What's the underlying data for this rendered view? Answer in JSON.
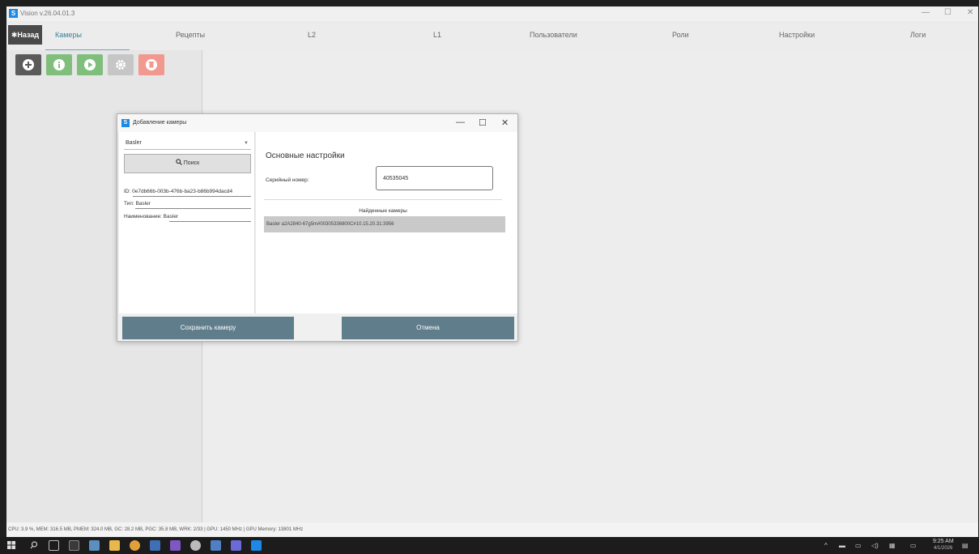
{
  "window": {
    "title": "Vision v.26.04.01.3"
  },
  "nav": {
    "back_label": "Назад",
    "tabs": [
      "Камеры",
      "Рецепты",
      "L2",
      "L1",
      "Пользователи",
      "Роли",
      "Настройки",
      "Логи"
    ],
    "active_tab": "Камеры"
  },
  "toolbar": {
    "buttons": [
      {
        "name": "add",
        "icon": "plus-circle-icon",
        "color": "#5a5a5a"
      },
      {
        "name": "info",
        "icon": "info-circle-icon",
        "color": "#7fbf7b"
      },
      {
        "name": "start",
        "icon": "play-circle-icon",
        "color": "#7fbf7b"
      },
      {
        "name": "settings",
        "icon": "gear-icon",
        "color": "#c6c6c6"
      },
      {
        "name": "delete",
        "icon": "trash-circle-icon",
        "color": "#f2998f"
      }
    ]
  },
  "dialog": {
    "title": "Добавление камеры",
    "camera_type": "Basler",
    "search_label": "Поиск",
    "id_line": "ID: 0e7db66b-003b-476b-ba23-b86b994dacd4",
    "type_line": "Тип: Basler",
    "name_line": "Наименование: Basler",
    "section_title": "Основные настройки",
    "serial_label": "Серийный номер:",
    "serial_value": "40535045",
    "found_title": "Найденные камеры",
    "found_items": [
      "Basler a2A2840-67g5m#00305336800C#10.15.20.31:3956"
    ],
    "save_label": "Сохранить камеру",
    "cancel_label": "Отмена"
  },
  "status": {
    "text": "CPU: 3.9 %, MEM: 316.5 MB, PMEM: 324.0 MB, GC: 28.2 MB, PGC: 35.8 MB, WRK: 2/33 | GPU: 1450 MHz | GPU Memory: 13801 MHz"
  },
  "taskbar": {
    "time": "9:25 AM",
    "date": "4/1/2026"
  },
  "colors": {
    "accent": "#37839c",
    "button": "#607d8b"
  }
}
